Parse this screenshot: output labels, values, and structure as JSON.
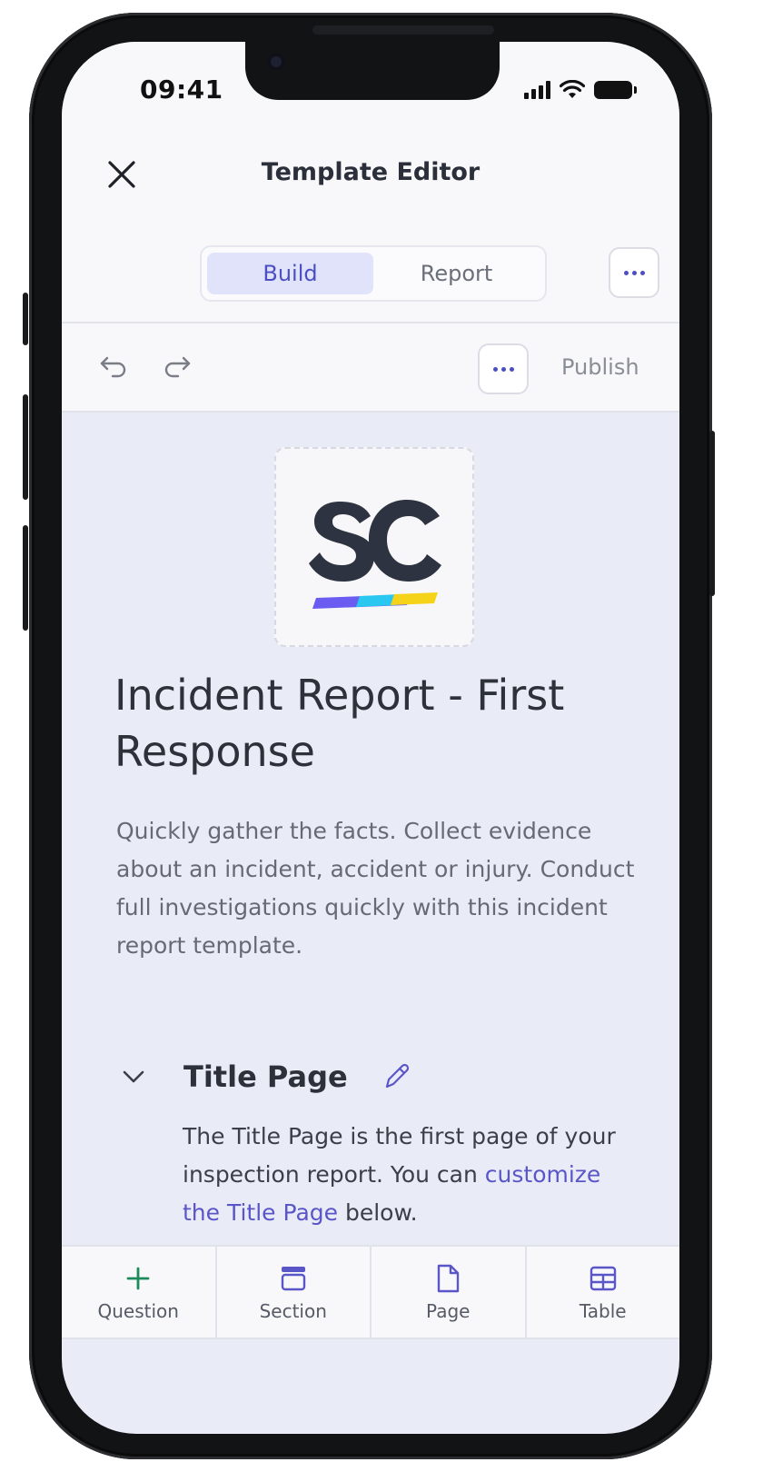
{
  "status_bar": {
    "time": "09:41"
  },
  "header": {
    "title": "Template Editor"
  },
  "tabs": [
    {
      "label": "Build",
      "active": true
    },
    {
      "label": "Report",
      "active": false
    }
  ],
  "actions": {
    "publish_label": "Publish"
  },
  "template": {
    "title": "Incident Report - First Response",
    "description": "Quickly gather the facts. Collect evidence about an incident, accident or injury. Conduct full investigations quickly with this incident report template."
  },
  "section": {
    "title": "Title Page",
    "desc_prefix": "The Title Page is the first page of your inspection report. You can ",
    "desc_link": "customize the Title Page",
    "desc_suffix": " below."
  },
  "toolbar": {
    "question": "Question",
    "section": "Section",
    "page": "Page",
    "table": "Table"
  },
  "colors": {
    "accent": "#4c4fc2",
    "add_green": "#1d8a5b",
    "content_bg": "#e9ecf7"
  }
}
